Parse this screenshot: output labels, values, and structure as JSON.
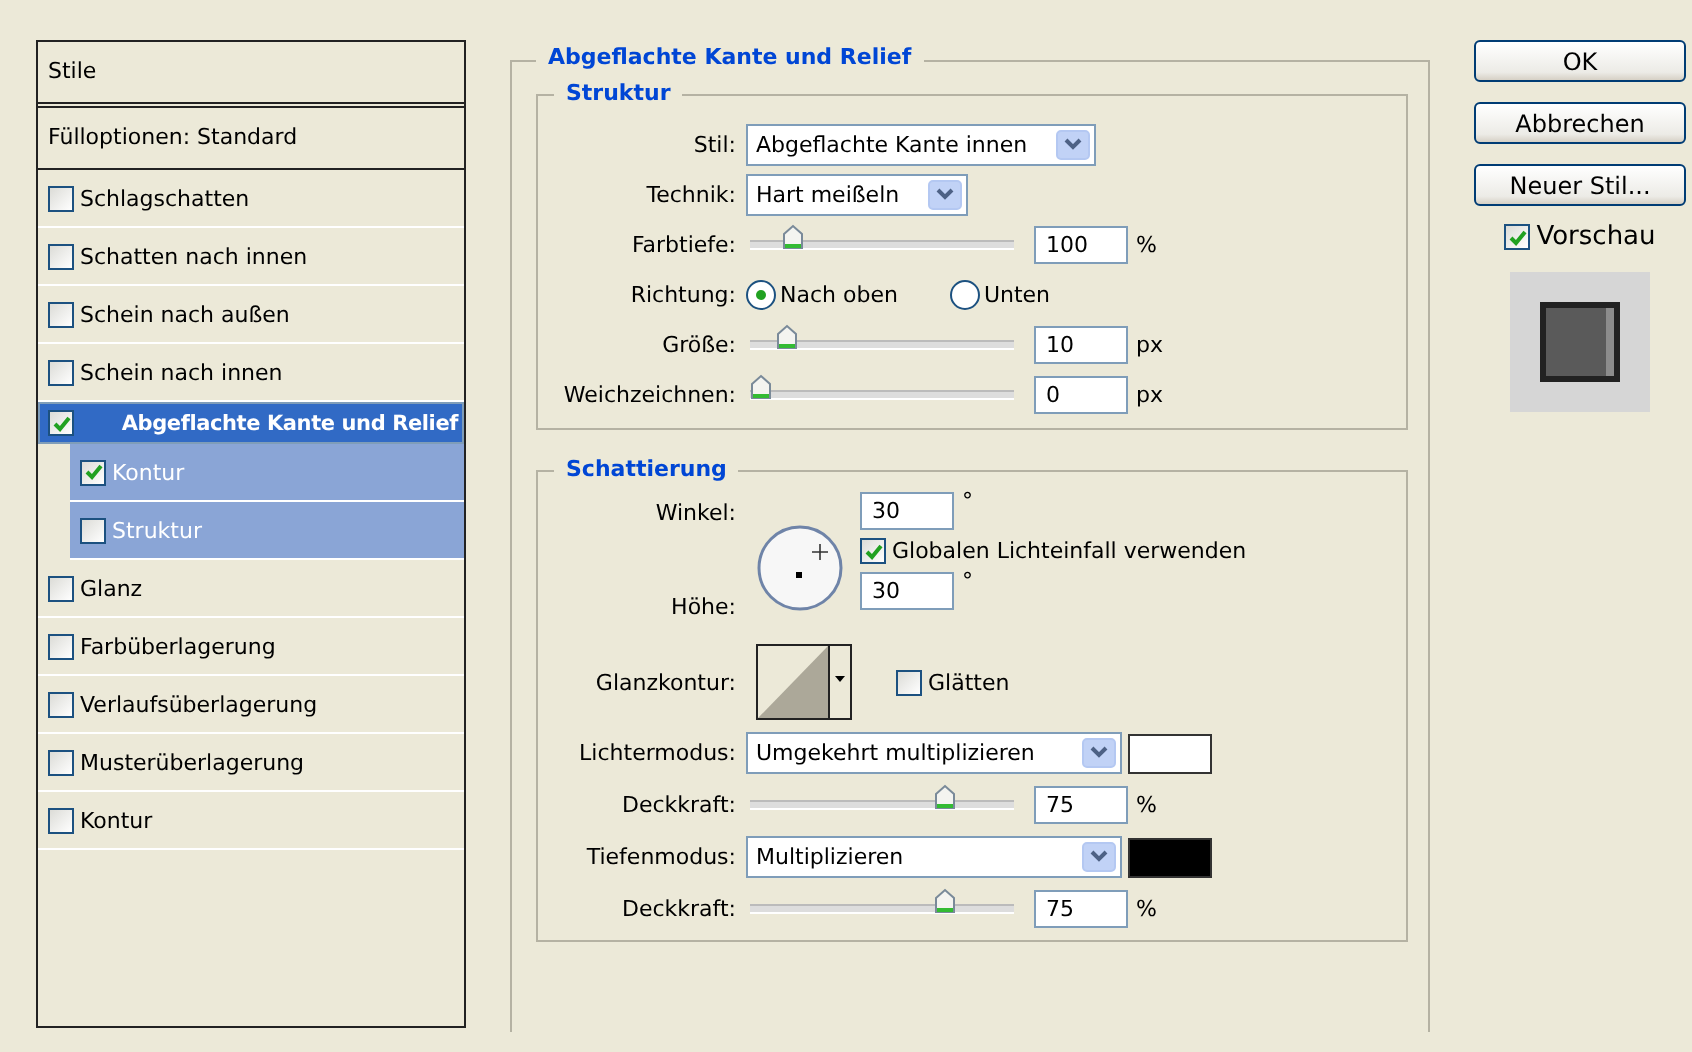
{
  "styles_panel": {
    "header": "Stile",
    "items": [
      {
        "kind": "option",
        "label": "Fülloptionen: Standard"
      },
      {
        "kind": "effect",
        "label": "Schlagschatten",
        "checked": false,
        "selected": false
      },
      {
        "kind": "effect",
        "label": "Schatten nach innen",
        "checked": false,
        "selected": false
      },
      {
        "kind": "effect",
        "label": "Schein nach außen",
        "checked": false,
        "selected": false
      },
      {
        "kind": "effect",
        "label": "Schein nach innen",
        "checked": false,
        "selected": false
      },
      {
        "kind": "effect",
        "label": "Abgeflachte Kante und Relief",
        "checked": true,
        "selected": true,
        "children": [
          {
            "label": "Kontur",
            "checked": true
          },
          {
            "label": "Struktur",
            "checked": false
          }
        ]
      },
      {
        "kind": "effect",
        "label": "Glanz",
        "checked": false,
        "selected": false
      },
      {
        "kind": "effect",
        "label": "Farbüberlagerung",
        "checked": false,
        "selected": false
      },
      {
        "kind": "effect",
        "label": "Verlaufsüberlagerung",
        "checked": false,
        "selected": false
      },
      {
        "kind": "effect",
        "label": "Musterüberlagerung",
        "checked": false,
        "selected": false
      },
      {
        "kind": "effect",
        "label": "Kontur",
        "checked": false,
        "selected": false
      }
    ]
  },
  "settings": {
    "title": "Abgeflachte Kante und Relief",
    "structure": {
      "title": "Struktur",
      "rows": [
        {
          "kind": "select",
          "label": "Stil:",
          "value": "Abgeflachte Kante innen"
        },
        {
          "kind": "select",
          "label": "Technik:",
          "value": "Hart meißeln"
        },
        {
          "kind": "slider",
          "label": "Farbtiefe:",
          "level": 0.13,
          "value": "100",
          "unit": "%"
        },
        {
          "kind": "radio",
          "label": "Richtung:",
          "options": [
            {
              "label": "Nach oben",
              "selected": true
            },
            {
              "label": "Unten",
              "selected": false
            }
          ]
        },
        {
          "kind": "slider",
          "label": "Größe:",
          "level": 0.11,
          "value": "10",
          "unit": "px"
        },
        {
          "kind": "slider",
          "label": "Weichzeichnen:",
          "level": 0,
          "value": "0",
          "unit": "px"
        }
      ]
    },
    "shading": {
      "title": "Schattierung",
      "angle_label": "Winkel:",
      "angle": "30",
      "angle_unit": "°",
      "global_light": {
        "label": "Globalen Lichteinfall verwenden",
        "checked": true
      },
      "altitude_label": "Höhe:",
      "altitude": "30",
      "altitude_unit": "°",
      "gloss_label": "Glanzkontur:",
      "antialias": {
        "label": "Glätten",
        "checked": false
      },
      "rows": [
        {
          "kind": "select",
          "label": "Lichtermodus:",
          "value": "Umgekehrt multiplizieren",
          "color": "#ffffff"
        },
        {
          "kind": "slider",
          "label": "Deckkraft:",
          "level": 0.75,
          "value": "75",
          "unit": "%"
        },
        {
          "kind": "select",
          "label": "Tiefenmodus:",
          "value": "Multiplizieren",
          "color": "#000000"
        },
        {
          "kind": "slider",
          "label": "Deckkraft:",
          "level": 0.75,
          "value": "75",
          "unit": "%"
        }
      ]
    }
  },
  "buttons": [
    {
      "label": "OK"
    },
    {
      "label": "Abbrechen"
    },
    {
      "label": "Neuer Stil..."
    }
  ],
  "preview": {
    "label": "Vorschau",
    "checked": true
  }
}
